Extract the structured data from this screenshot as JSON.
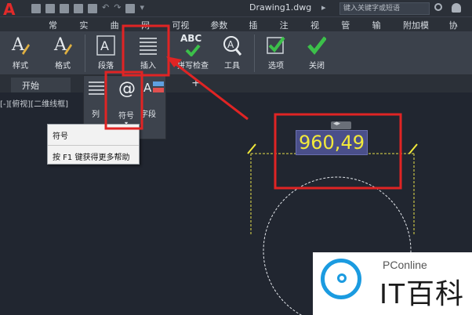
{
  "app": {
    "logo_letter": "A",
    "document_title": "Drawing1.dwg",
    "search_placeholder": "键入关键字或短语",
    "title_arrow": "▸"
  },
  "quick_access": [
    "new-icon",
    "open-icon",
    "save-icon",
    "save-as-icon",
    "plot-icon",
    "undo-icon",
    "redo-icon",
    "share-icon",
    "workspace-dropdown-icon"
  ],
  "ribbon_tabs": [
    "常用",
    "实体",
    "曲面",
    "网格",
    "可视化",
    "参数化",
    "插入",
    "注释",
    "视图",
    "管理",
    "输出",
    "附加模块",
    "协作"
  ],
  "ribbon_buttons": {
    "style": "样式",
    "format": "格式",
    "paragraph": "段落",
    "insert": "插入",
    "spellcheck": "拼写检查",
    "spellcheck_abc": "ABC",
    "tools": "工具",
    "options": "选项",
    "close": "关闭"
  },
  "insert_menu": {
    "columns": "列",
    "symbol": "符号",
    "symbol_glyph": "@",
    "field": "字段"
  },
  "tooltip": {
    "title": "符号",
    "help": "按 F1 键获得更多帮助"
  },
  "document_tabs": {
    "start": "开始",
    "add": "+"
  },
  "viewport_label": "[-][俯视][二维线框]",
  "mtext_value": "960,49",
  "watermark": {
    "brand": "PConline",
    "name": "IT百科"
  },
  "colors": {
    "highlight_red": "#e02424",
    "mtext_yellow": "#f2e93a",
    "mtext_bg": "#4a4f8a",
    "check_green": "#3cc04a",
    "watermark_blue": "#1b9be0"
  }
}
